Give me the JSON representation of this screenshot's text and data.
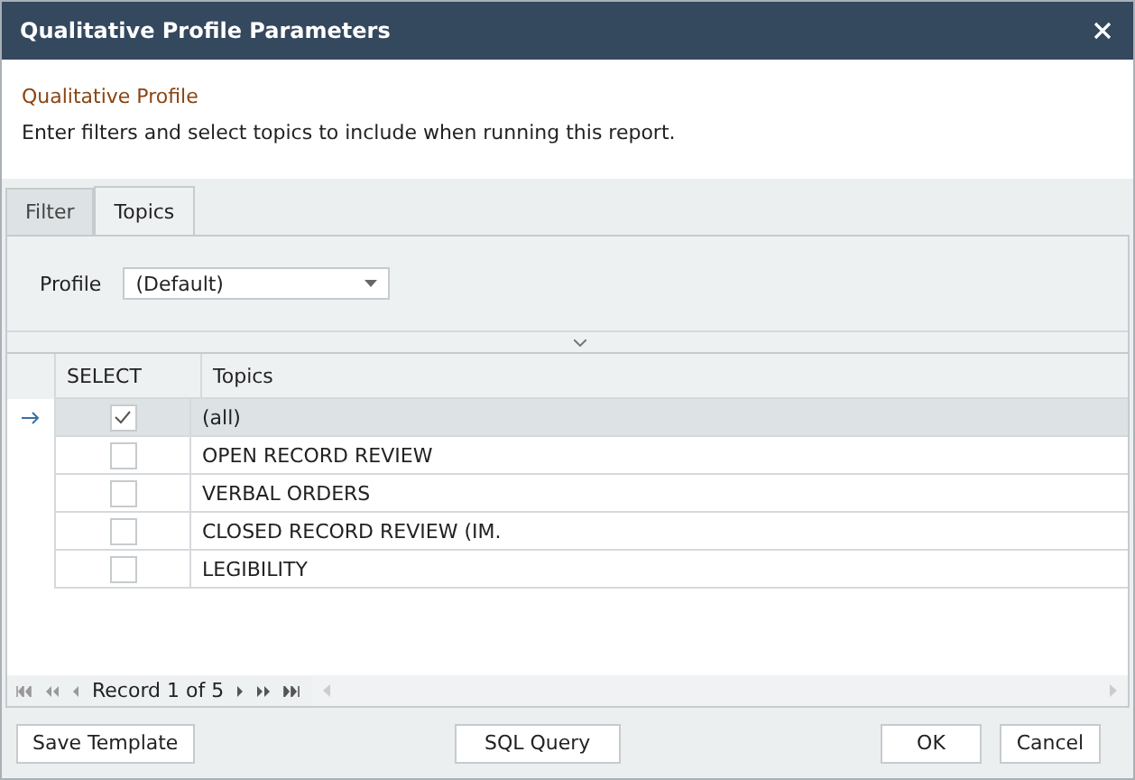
{
  "window": {
    "title": "Qualitative Profile Parameters"
  },
  "header": {
    "title": "Qualitative Profile",
    "description": "Enter filters and select topics to include when running this report."
  },
  "tabs": [
    {
      "label": "Filter",
      "selected": false
    },
    {
      "label": "Topics",
      "selected": true
    }
  ],
  "profile": {
    "label": "Profile",
    "value": "(Default)"
  },
  "table": {
    "columns": [
      "SELECT",
      "Topics"
    ],
    "rows": [
      {
        "topic": "(all)",
        "checked": true,
        "selected": true
      },
      {
        "topic": "OPEN RECORD REVIEW",
        "checked": false,
        "selected": false
      },
      {
        "topic": "VERBAL ORDERS",
        "checked": false,
        "selected": false
      },
      {
        "topic": "CLOSED RECORD REVIEW (IM.",
        "checked": false,
        "selected": false
      },
      {
        "topic": "LEGIBILITY",
        "checked": false,
        "selected": false
      }
    ]
  },
  "navigator": {
    "record": "Record 1 of 5"
  },
  "buttons": [
    {
      "label": "Save Template",
      "kind": "left"
    },
    {
      "label": "SQL Query",
      "kind": "center"
    },
    {
      "label": "OK",
      "kind": "right"
    },
    {
      "label": "Cancel",
      "kind": "right"
    }
  ]
}
